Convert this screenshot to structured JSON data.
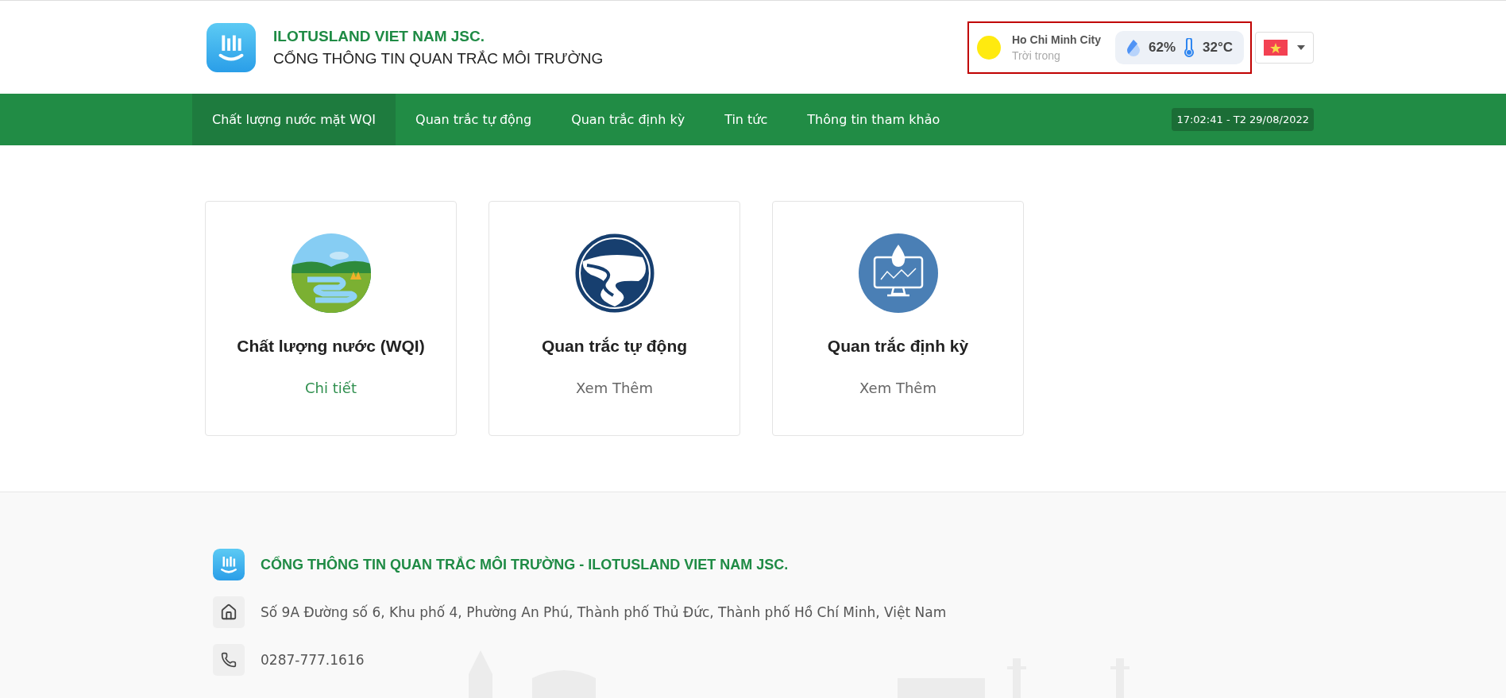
{
  "header": {
    "company": "ILOTUSLAND VIET NAM JSC.",
    "portal_title": "CỔNG THÔNG TIN QUAN TRẮC MÔI TRƯỜNG",
    "weather": {
      "city": "Ho Chi Minh City",
      "condition": "Trời trong",
      "humidity": "62%",
      "temperature": "32°C",
      "highlighted": true
    }
  },
  "nav": {
    "items": [
      {
        "label": "Chất lượng nước mặt WQI",
        "selected": true
      },
      {
        "label": "Quan trắc tự động",
        "selected": false
      },
      {
        "label": "Quan trắc định kỳ",
        "selected": false
      },
      {
        "label": "Tin tức",
        "selected": false
      },
      {
        "label": "Thông tin tham khảo",
        "selected": false
      }
    ],
    "datetime": "17:02:41 - T2 29/08/2022"
  },
  "cards": [
    {
      "kind": "landscape",
      "title": "Chất lượng nước (WQI)",
      "link": "Chi tiết",
      "selected": true
    },
    {
      "kind": "river",
      "title": "Quan trắc tự động",
      "link": "Xem Thêm",
      "selected": false
    },
    {
      "kind": "monitor",
      "title": "Quan trắc định kỳ",
      "link": "Xem Thêm",
      "selected": false
    }
  ],
  "footer": {
    "title": "CỔNG THÔNG TIN QUAN TRẮC MÔI TRƯỜNG - ILOTUSLAND VIET NAM JSC.",
    "contacts": [
      {
        "kind": "address",
        "text": "Số 9A Đường số 6, Khu phố 4, Phường An Phú, Thành phố Thủ Đức, Thành phố Hồ Chí Minh, Việt Nam"
      },
      {
        "kind": "phone",
        "text": "0287-777.1616"
      }
    ]
  }
}
